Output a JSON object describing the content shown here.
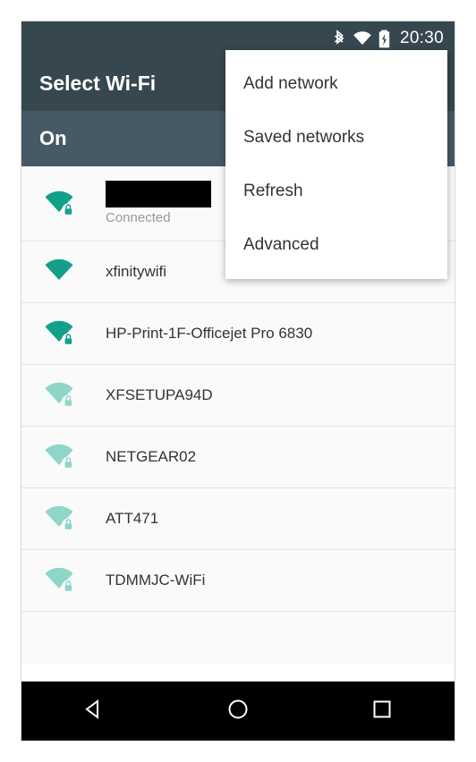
{
  "statusbar": {
    "time": "20:30",
    "icons": [
      "bluetooth-icon",
      "wifi-icon",
      "battery-charging-icon"
    ]
  },
  "appbar": {
    "title": "Select Wi-Fi"
  },
  "toggle_band": {
    "label": "On"
  },
  "overflow_menu": {
    "items": [
      {
        "label": "Add network"
      },
      {
        "label": "Saved networks"
      },
      {
        "label": "Refresh"
      },
      {
        "label": "Advanced"
      }
    ]
  },
  "networks": [
    {
      "ssid": "",
      "redacted": true,
      "status": "Connected",
      "secured": true,
      "signal": "full"
    },
    {
      "ssid": "xfinitywifi",
      "redacted": false,
      "status": "",
      "secured": false,
      "signal": "full"
    },
    {
      "ssid": "HP-Print-1F-Officejet Pro 6830",
      "redacted": false,
      "status": "",
      "secured": true,
      "signal": "full"
    },
    {
      "ssid": "XFSETUPA94D",
      "redacted": false,
      "status": "",
      "secured": true,
      "signal": "weak"
    },
    {
      "ssid": "NETGEAR02",
      "redacted": false,
      "status": "",
      "secured": true,
      "signal": "weak"
    },
    {
      "ssid": "ATT471",
      "redacted": false,
      "status": "",
      "secured": true,
      "signal": "weak"
    },
    {
      "ssid": "TDMMJC-WiFi",
      "redacted": false,
      "status": "",
      "secured": true,
      "signal": "weak"
    }
  ],
  "navbar": {
    "back_label": "back-button",
    "home_label": "home-button",
    "recents_label": "recents-button"
  },
  "colors": {
    "statusbar_bg": "#37474f",
    "appbar_bg": "#37474f",
    "band_bg": "#455a64",
    "wifi_strong": "#13a08a",
    "wifi_weak": "#8ed6c8",
    "list_bg": "#fafafa"
  }
}
